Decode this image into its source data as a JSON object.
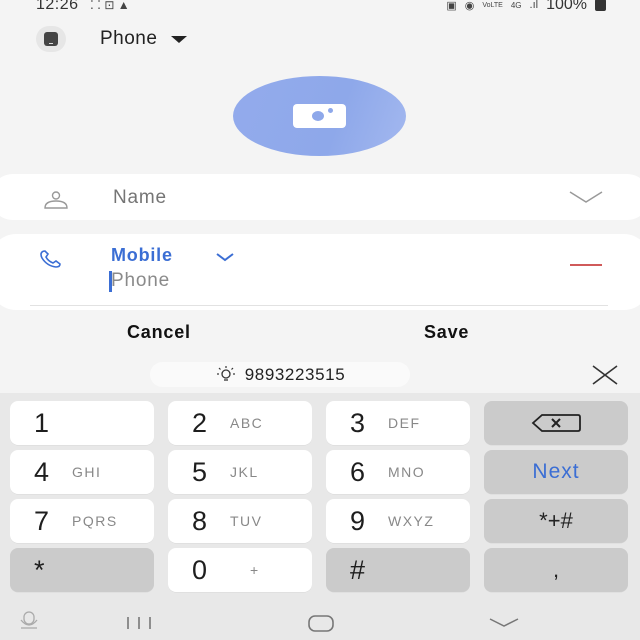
{
  "status_bar": {
    "time": "12:26",
    "battery": "100%",
    "network_labels": [
      "VoLTE",
      "4G"
    ]
  },
  "storage": {
    "label": "Phone",
    "icon": "phone-storage-icon"
  },
  "contact_photo": {
    "icon": "camera-icon"
  },
  "name_field": {
    "placeholder": "Name",
    "value": "",
    "icon": "person-icon",
    "expand_icon": "chevron-down-icon"
  },
  "phone_field": {
    "type_label": "Mobile",
    "placeholder": "Phone",
    "value": "",
    "icon": "phone-icon",
    "remove_icon": "minus-icon"
  },
  "actions": {
    "cancel_label": "Cancel",
    "save_label": "Save"
  },
  "suggestion": {
    "icon": "lightbulb-icon",
    "text": "9893223515",
    "close_icon": "close-icon"
  },
  "keyboard": {
    "rows": [
      [
        {
          "num": "1",
          "letters": ""
        },
        {
          "num": "2",
          "letters": "ABC"
        },
        {
          "num": "3",
          "letters": "DEF"
        },
        {
          "special": "backspace"
        }
      ],
      [
        {
          "num": "4",
          "letters": "GHI"
        },
        {
          "num": "5",
          "letters": "JKL"
        },
        {
          "num": "6",
          "letters": "MNO"
        },
        {
          "special": "next",
          "label": "Next"
        }
      ],
      [
        {
          "num": "7",
          "letters": "PQRS"
        },
        {
          "num": "8",
          "letters": "TUV"
        },
        {
          "num": "9",
          "letters": "WXYZ"
        },
        {
          "special": "symbols",
          "label": "*+#"
        }
      ],
      [
        {
          "num": "*",
          "letters": "",
          "dark": true
        },
        {
          "num": "0",
          "letters": "+"
        },
        {
          "num": "#",
          "letters": "",
          "dark": true
        },
        {
          "special": "comma",
          "label": ","
        }
      ]
    ]
  },
  "nav_bar": {
    "items": [
      "voice-input-icon",
      "recent-apps-icon",
      "home-icon",
      "hide-keyboard-icon"
    ]
  }
}
